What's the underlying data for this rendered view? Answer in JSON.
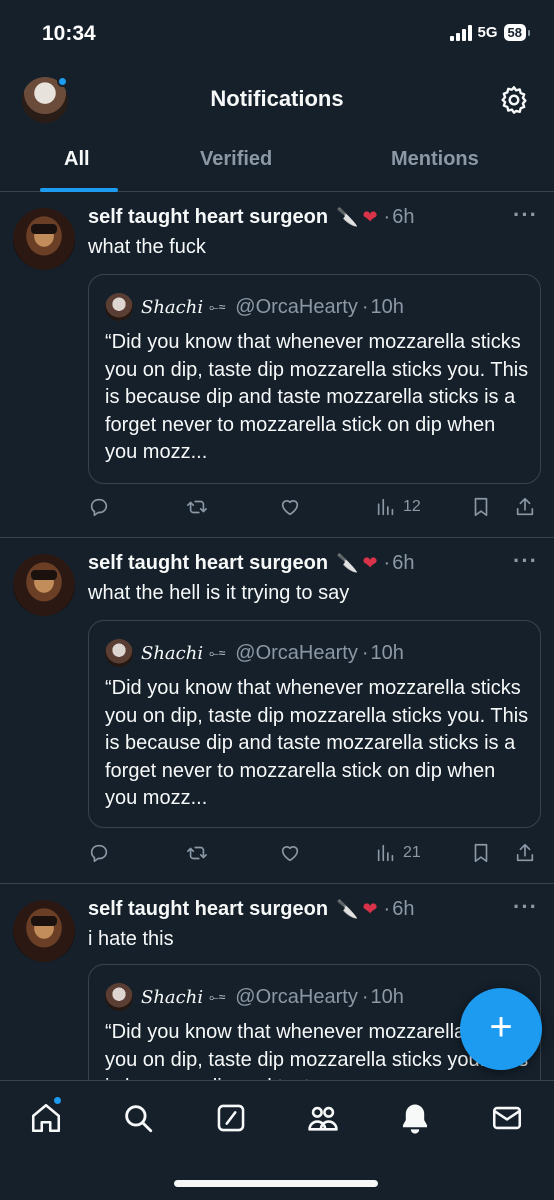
{
  "status_bar": {
    "time": "10:34",
    "network": "5G",
    "battery": "58"
  },
  "header": {
    "title": "Notifications"
  },
  "tabs": [
    {
      "label": "All",
      "active": true
    },
    {
      "label": "Verified",
      "active": false
    },
    {
      "label": "Mentions",
      "active": false
    }
  ],
  "tweets": [
    {
      "author": "self taught heart surgeon",
      "time": "6h",
      "text": "what the fuck",
      "quote": {
        "name": "Shachi",
        "handle": "@OrcaHearty",
        "time": "10h",
        "text": "“Did you know that whenever mozzarella sticks you on dip, taste dip mozzarella sticks you. This is because dip and taste mozzarella sticks is a forget never to mozzarella stick on dip when you mozz..."
      },
      "views": "12"
    },
    {
      "author": "self taught heart surgeon",
      "time": "6h",
      "text": "what the hell is it trying to say",
      "quote": {
        "name": "Shachi",
        "handle": "@OrcaHearty",
        "time": "10h",
        "text": "“Did you know that whenever mozzarella sticks you on dip, taste dip mozzarella sticks you. This is because dip and taste mozzarella sticks is a forget never to mozzarella stick on dip when you mozz..."
      },
      "views": "21"
    },
    {
      "author": "self taught heart surgeon",
      "time": "6h",
      "text": "i hate this",
      "quote": {
        "name": "Shachi",
        "handle": "@OrcaHearty",
        "time": "10h",
        "text": "“Did you know that whenever mozzarella sticks you on dip, taste dip mozzarella sticks you. This is because dip and taste"
      }
    }
  ],
  "separators": {
    "dot": "·",
    "more": "···",
    "fab": "+"
  },
  "colors": {
    "background": "#15202b",
    "accent": "#1d9bf0",
    "divider": "#38444d",
    "muted": "#8b98a5"
  },
  "icons": [
    "gear-icon",
    "reply-icon",
    "retweet-icon",
    "like-icon",
    "views-icon",
    "bookmark-icon",
    "share-icon",
    "home-icon",
    "search-icon",
    "grok-icon",
    "communities-icon",
    "bell-icon",
    "mail-icon"
  ]
}
